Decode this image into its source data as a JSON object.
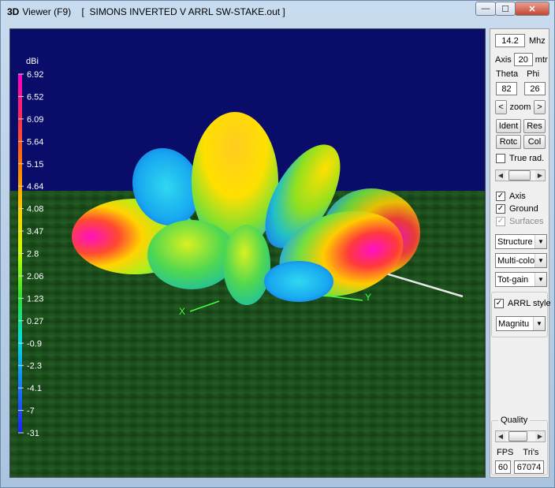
{
  "window": {
    "logo": "3D",
    "title": "Viewer (F9)    [  SIMONS INVERTED V ARRL SW-STAKE.out ]",
    "minimize_glyph": "—",
    "maximize_glyph": "☐",
    "close_glyph": "✕"
  },
  "legend": {
    "unit": "dBi",
    "ticks": [
      "6.92",
      "6.52",
      "6.09",
      "5.64",
      "5.15",
      "4.64",
      "4.08",
      "3.47",
      "2.8",
      "2.06",
      "1.23",
      "0.27",
      "-0.9",
      "-2.3",
      "-4.1",
      "-7",
      "-31"
    ]
  },
  "axes": {
    "x_label": "X",
    "y_label": "Y"
  },
  "panel": {
    "freq": {
      "value": "14.2",
      "unit": "Mhz"
    },
    "axis": {
      "label": "Axis",
      "value": "20",
      "unit": "mtr"
    },
    "theta": {
      "label": "Theta",
      "value": "82"
    },
    "phi": {
      "label": "Phi",
      "value": "26"
    },
    "zoom": {
      "left": "<",
      "label": "zoom",
      "right": ">"
    },
    "buttons": {
      "ident": "Ident",
      "res": "Res",
      "rotc": "Rotc",
      "col": "Col"
    },
    "true_rad": {
      "label": "True rad.",
      "checked": false
    },
    "checks": {
      "axis": {
        "label": "Axis",
        "checked": true
      },
      "ground": {
        "label": "Ground",
        "checked": true
      },
      "surfaces": {
        "label": "Surfaces",
        "checked": true
      }
    },
    "selects": {
      "structure": "Structure",
      "multicolor": "Multi-colo",
      "totgain": "Tot-gain"
    },
    "arrl": {
      "label": "ARRL style",
      "checked": true,
      "select": "Magnitu"
    },
    "quality": {
      "title": "Quality",
      "fps_label": "FPS",
      "fps": "60",
      "tris_label": "Tri's",
      "tris": "67074"
    }
  },
  "colors": {
    "sky": "#0a0c6a",
    "ground": "#1f5a1f",
    "title_bg": "#bcd3ea"
  }
}
